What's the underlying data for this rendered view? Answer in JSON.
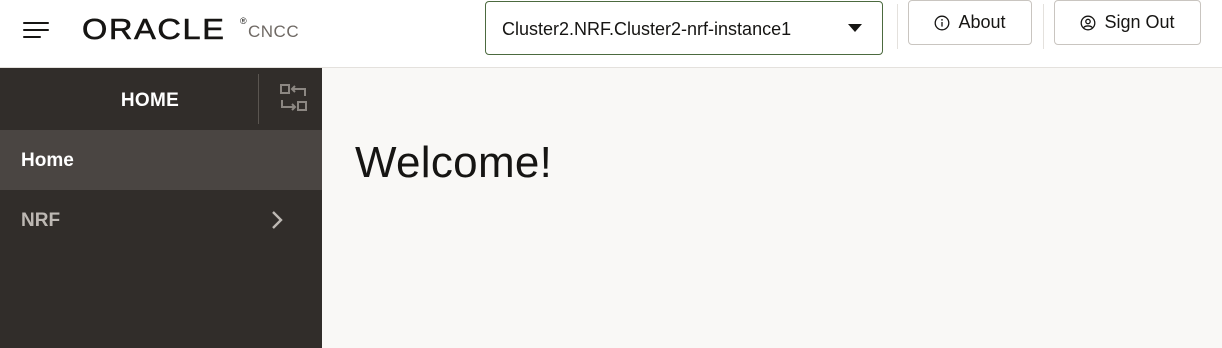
{
  "header": {
    "logo_text": "ORACLE",
    "logo_reg": "®",
    "app_name": "CNCC",
    "instance_selector": {
      "value": "Cluster2.NRF.Cluster2-nrf-instance1"
    },
    "about_label": "About",
    "signout_label": "Sign Out"
  },
  "sidebar": {
    "title": "HOME",
    "items": [
      {
        "label": "Home",
        "selected": true
      },
      {
        "label": "NRF",
        "expandable": true
      }
    ]
  },
  "main": {
    "welcome": "Welcome!"
  },
  "colors": {
    "sidebar_bg": "#312d2a",
    "sidebar_selected_bg": "#4a4542",
    "selector_border": "#4c6a3f",
    "content_bg": "#f9f8f6"
  },
  "icons": [
    "menu-icon",
    "info-icon",
    "user-circle-icon",
    "collapse-icon",
    "chevron-right-icon",
    "caret-down-icon"
  ]
}
